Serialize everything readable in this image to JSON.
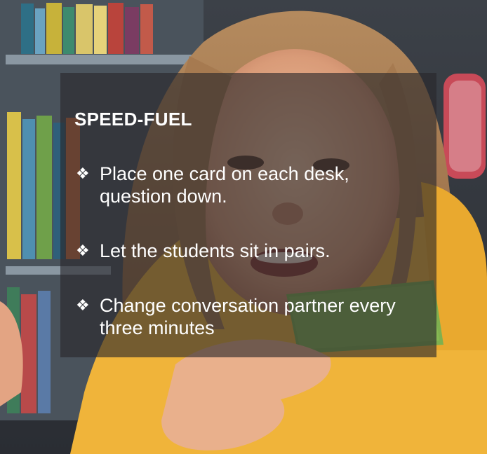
{
  "slide": {
    "title": "SPEED-FUEL",
    "bullet_icon": "diamond-bullet-icon",
    "bullet_glyph": "❖",
    "bullets": [
      "Place one card on each desk, question down.",
      "Let the students sit in pairs.",
      "Change conversation partner every three minutes"
    ]
  },
  "colors": {
    "text": "#ffffff",
    "overlay": "#28262a",
    "card": "#7fb04f",
    "shirt": "#f0b43a"
  }
}
